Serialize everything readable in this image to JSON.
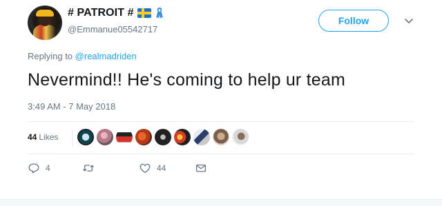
{
  "tweet": {
    "display_name": "# PATROIT #",
    "handle": "@Emmanue05542717",
    "follow_label": "Follow",
    "replying_prefix": "Replying to",
    "replying_to": "@realmadriden",
    "text": "Nevermind!! He's coming to help ur team",
    "timestamp": "3:49 AM - 7 May 2018"
  },
  "stats": {
    "likes_count": "44",
    "likes_label": "Likes"
  },
  "actions": {
    "reply_count": "4",
    "retweet_count": "",
    "like_count": "44"
  },
  "colors": {
    "accent": "#1da1f2",
    "secondary_text": "#657786",
    "primary_text": "#14171a",
    "divider": "#e6ecf0"
  },
  "icons": {
    "flag": "sweden-flag-icon",
    "ribbon": "blue-ribbon-icon",
    "caret": "chevron-down-icon",
    "reply": "reply-icon",
    "retweet": "retweet-icon",
    "like": "heart-icon",
    "dm": "envelope-icon"
  }
}
